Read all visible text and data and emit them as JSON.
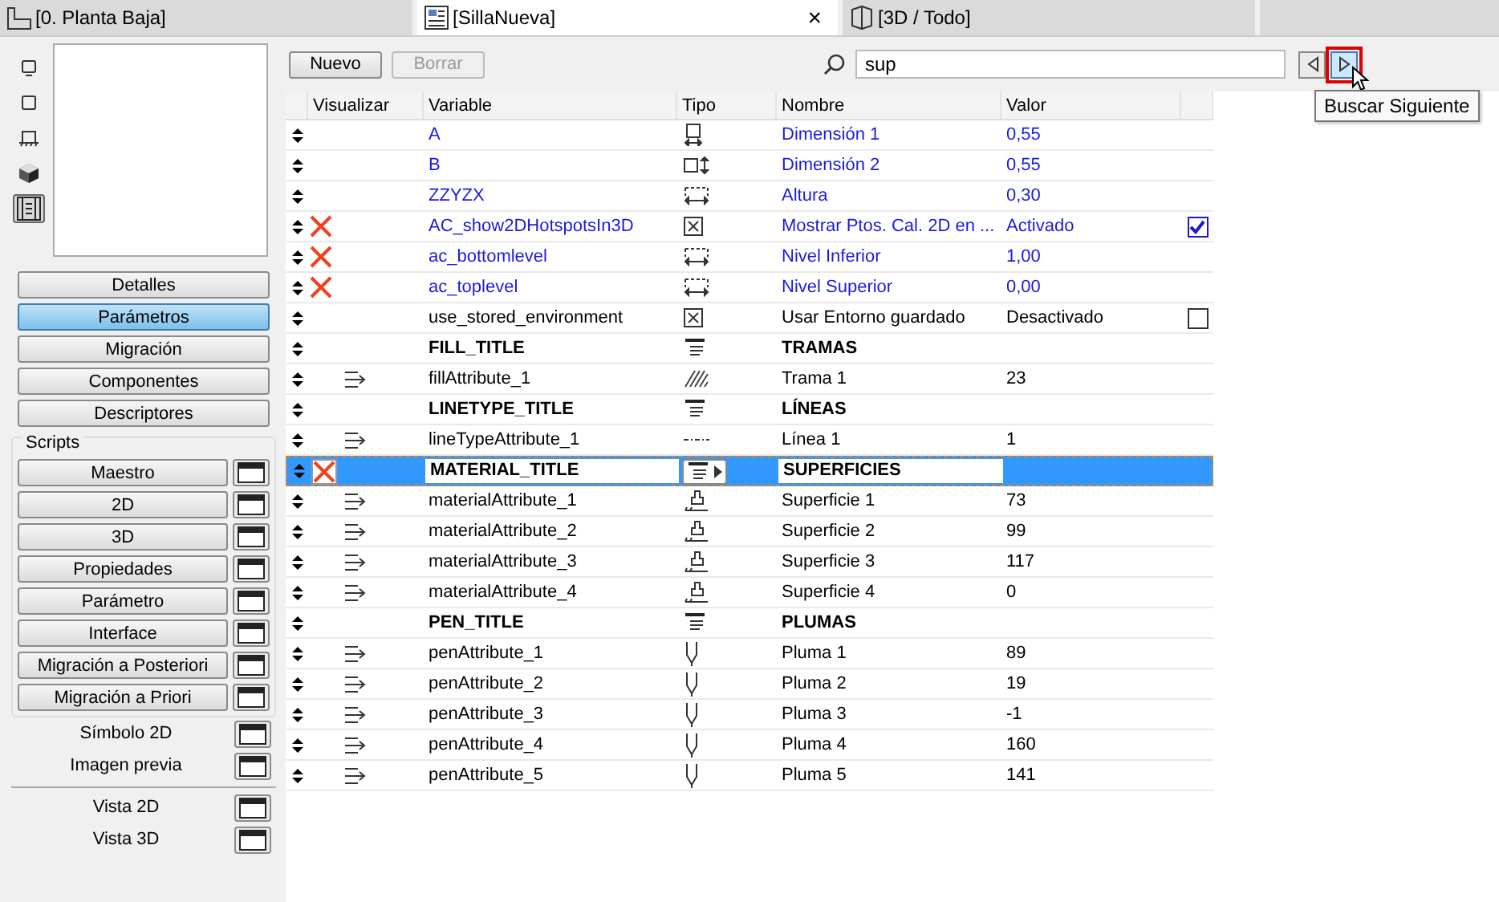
{
  "tabs": [
    {
      "label": "[0. Planta Baja]",
      "kind": "plan",
      "selected": false
    },
    {
      "label": "[SillaNueva]",
      "kind": "object",
      "selected": true,
      "close": "×"
    },
    {
      "label": "[3D / Todo]",
      "kind": "view3d",
      "selected": false
    }
  ],
  "sidebar": {
    "view_icons": [
      {
        "kind": "symbol",
        "selected": false
      },
      {
        "kind": "square",
        "selected": false
      },
      {
        "kind": "elevation",
        "selected": false
      },
      {
        "kind": "cube",
        "selected": false
      },
      {
        "kind": "list",
        "selected": true
      }
    ],
    "sections": [
      {
        "label": "Detalles",
        "selected": false
      },
      {
        "label": "Parámetros",
        "selected": true
      },
      {
        "label": "Migración",
        "selected": false
      },
      {
        "label": "Componentes",
        "selected": false
      },
      {
        "label": "Descriptores",
        "selected": false
      }
    ],
    "scripts": {
      "title": "Scripts",
      "items": [
        "Maestro",
        "2D",
        "3D",
        "Propiedades",
        "Parámetro",
        "Interface",
        "Migración a Posteriori",
        "Migración a Priori"
      ]
    },
    "extras": [
      "Símbolo 2D",
      "Imagen previa"
    ],
    "views": [
      "Vista 2D",
      "Vista 3D"
    ]
  },
  "toolbar": {
    "buttons": [
      {
        "label": "Nuevo",
        "disabled": false
      },
      {
        "label": "Borrar",
        "disabled": true
      }
    ],
    "search": {
      "value": "sup"
    },
    "nav": [
      {
        "kind": "prev",
        "highlighted": false
      },
      {
        "kind": "next",
        "highlighted": true
      }
    ],
    "tooltip": "Buscar Siguiente"
  },
  "table": {
    "columns": [
      "Visualizar",
      "Variable",
      "Tipo",
      "Nombre",
      "Valor"
    ],
    "rows": [
      {
        "variable": "A",
        "kind": "width",
        "name": "Dimensión 1",
        "value": "0,55",
        "hidden": false,
        "child": false,
        "blue": true,
        "selected": false
      },
      {
        "variable": "B",
        "kind": "depth",
        "name": "Dimensión 2",
        "value": "0,55",
        "hidden": false,
        "child": false,
        "blue": true,
        "selected": false
      },
      {
        "variable": "ZZYZX",
        "kind": "length",
        "name": "Altura",
        "value": "0,30",
        "hidden": false,
        "child": false,
        "blue": true,
        "selected": false
      },
      {
        "variable": "AC_show2DHotspotsIn3D",
        "kind": "boolean",
        "name": "Mostrar Ptos. Cal. 2D en ...",
        "value": "Activado",
        "checked": true,
        "hidden": true,
        "child": false,
        "blue": true,
        "selected": false
      },
      {
        "variable": "ac_bottomlevel",
        "kind": "length",
        "name": "Nivel Inferior",
        "value": "1,00",
        "hidden": true,
        "child": false,
        "blue": true,
        "selected": false
      },
      {
        "variable": "ac_toplevel",
        "kind": "length",
        "name": "Nivel Superior",
        "value": "0,00",
        "hidden": true,
        "child": false,
        "blue": true,
        "selected": false
      },
      {
        "variable": "use_stored_environment",
        "kind": "boolean",
        "name": "Usar Entorno guardado",
        "value": "Desactivado",
        "checked": false,
        "hidden": false,
        "child": false,
        "blue": false,
        "selected": false
      },
      {
        "variable": "FILL_TITLE",
        "kind": "title",
        "name": "TRAMAS",
        "hidden": false,
        "child": false,
        "blue": false,
        "selected": false
      },
      {
        "variable": "fillAttribute_1",
        "kind": "fill",
        "name": "Trama 1",
        "value": "23",
        "hidden": false,
        "child": true,
        "blue": false,
        "selected": false
      },
      {
        "variable": "LINETYPE_TITLE",
        "kind": "title",
        "name": "LÍNEAS",
        "hidden": false,
        "child": false,
        "blue": false,
        "selected": false
      },
      {
        "variable": "lineTypeAttribute_1",
        "kind": "linetype",
        "name": "Línea 1",
        "value": "1",
        "hidden": false,
        "child": true,
        "blue": false,
        "selected": false
      },
      {
        "variable": "MATERIAL_TITLE",
        "kind": "title",
        "name": "SUPERFICIES",
        "hidden": true,
        "child": false,
        "blue": false,
        "selected": true
      },
      {
        "variable": "materialAttribute_1",
        "kind": "material",
        "name": "Superficie 1",
        "value": "73",
        "hidden": false,
        "child": true,
        "blue": false,
        "selected": false
      },
      {
        "variable": "materialAttribute_2",
        "kind": "material",
        "name": "Superficie 2",
        "value": "99",
        "hidden": false,
        "child": true,
        "blue": false,
        "selected": false
      },
      {
        "variable": "materialAttribute_3",
        "kind": "material",
        "name": "Superficie 3",
        "value": "117",
        "hidden": false,
        "child": true,
        "blue": false,
        "selected": false
      },
      {
        "variable": "materialAttribute_4",
        "kind": "material",
        "name": "Superficie 4",
        "value": "0",
        "hidden": false,
        "child": true,
        "blue": false,
        "selected": false
      },
      {
        "variable": "PEN_TITLE",
        "kind": "title",
        "name": "PLUMAS",
        "hidden": false,
        "child": false,
        "blue": false,
        "selected": false
      },
      {
        "variable": "penAttribute_1",
        "kind": "pen",
        "name": "Pluma 1",
        "value": "89",
        "hidden": false,
        "child": true,
        "blue": false,
        "selected": false
      },
      {
        "variable": "penAttribute_2",
        "kind": "pen",
        "name": "Pluma 2",
        "value": "19",
        "hidden": false,
        "child": true,
        "blue": false,
        "selected": false
      },
      {
        "variable": "penAttribute_3",
        "kind": "pen",
        "name": "Pluma 3",
        "value": "-1",
        "hidden": false,
        "child": true,
        "blue": false,
        "selected": false
      },
      {
        "variable": "penAttribute_4",
        "kind": "pen",
        "name": "Pluma 4",
        "value": "160",
        "hidden": false,
        "child": true,
        "blue": false,
        "selected": false
      },
      {
        "variable": "penAttribute_5",
        "kind": "pen",
        "name": "Pluma 5",
        "value": "141",
        "hidden": false,
        "child": true,
        "blue": false,
        "selected": false
      }
    ]
  }
}
